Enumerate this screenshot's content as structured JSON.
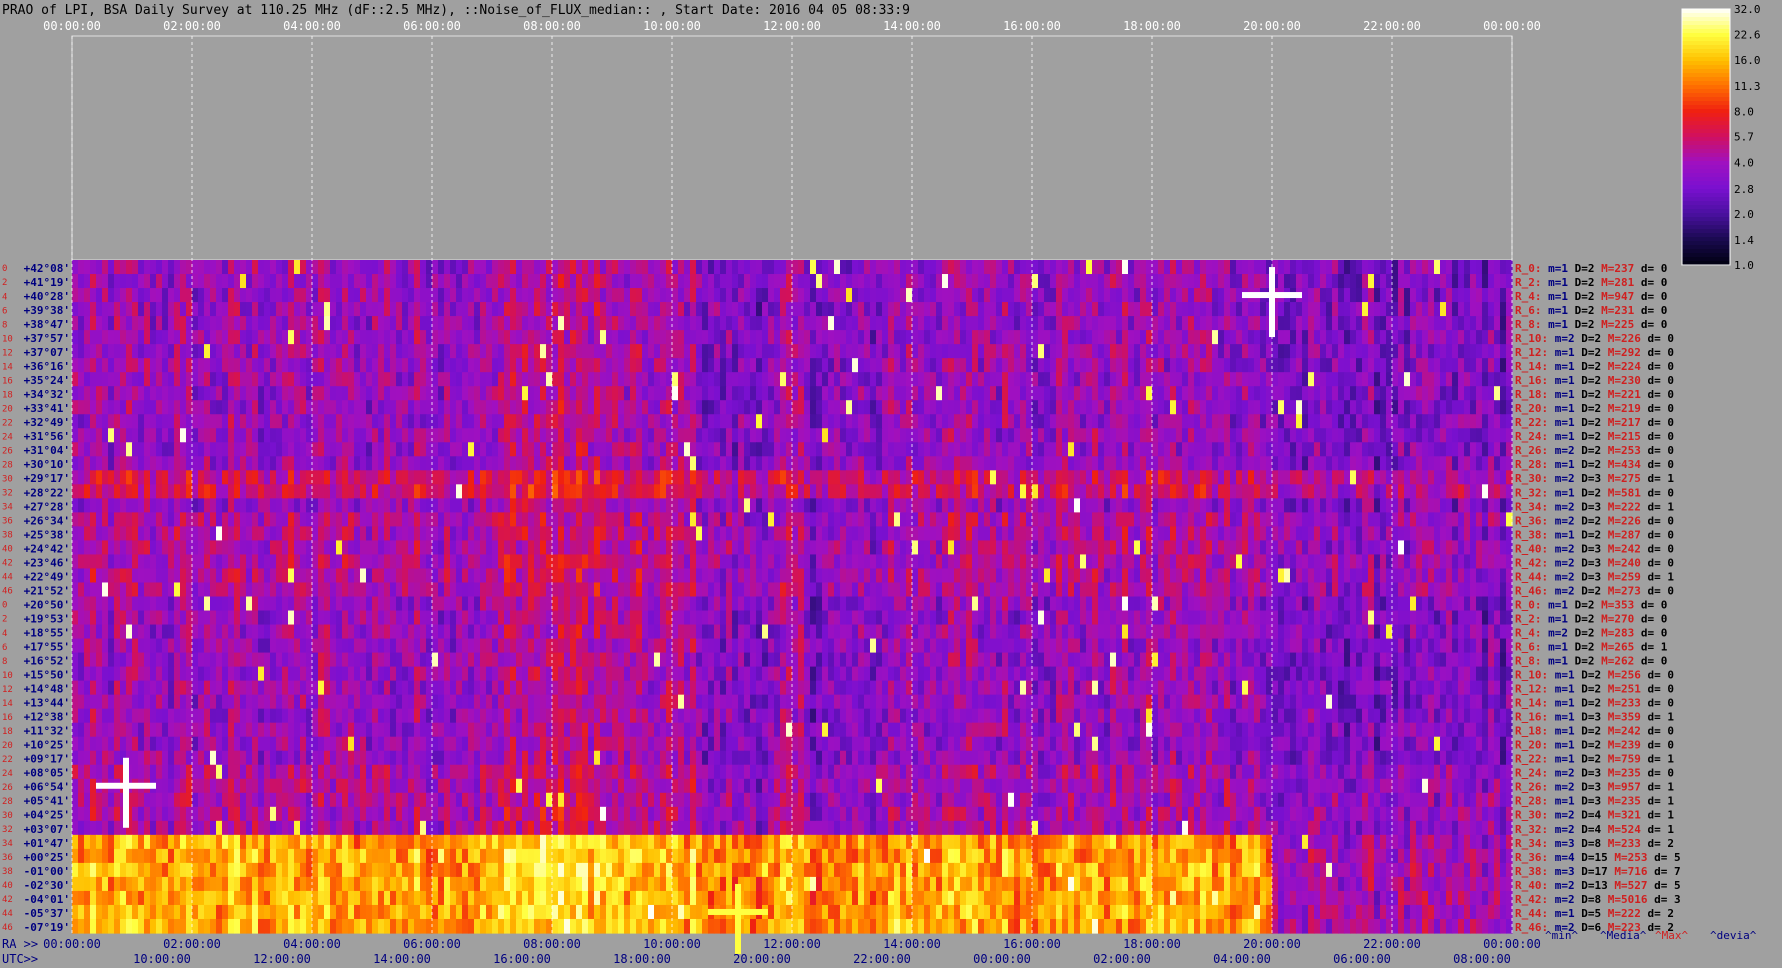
{
  "chart_data": {
    "type": "heatmap",
    "title": "PRAO of LPI, BSA Daily Survey at 110.25 MHz (dF::2.5 MHz), ::Noise_of_FLUX_median:: , Start Date: 2016 04 05 08:33:9",
    "top_time_ticks": [
      "00:00:00",
      "02:00:00",
      "04:00:00",
      "06:00:00",
      "08:00:00",
      "10:00:00",
      "12:00:00",
      "14:00:00",
      "16:00:00",
      "18:00:00",
      "20:00:00",
      "22:00:00",
      "00:00:00"
    ],
    "ra_axis_label": "RA >>",
    "ra_ticks": [
      "00:00:00",
      "02:00:00",
      "04:00:00",
      "06:00:00",
      "08:00:00",
      "10:00:00",
      "12:00:00",
      "14:00:00",
      "16:00:00",
      "18:00:00",
      "20:00:00",
      "22:00:00",
      "00:00:00"
    ],
    "utc_axis_label": "UTC>>",
    "utc_ticks": [
      "10:00:00",
      "12:00:00",
      "14:00:00",
      "16:00:00",
      "18:00:00",
      "20:00:00",
      "22:00:00",
      "00:00:00",
      "02:00:00",
      "04:00:00",
      "06:00:00",
      "08:00:00"
    ],
    "row_indices": [
      "0",
      "2",
      "4",
      "6",
      "8",
      "10",
      "12",
      "14",
      "16",
      "18",
      "20",
      "22",
      "24",
      "26",
      "28",
      "30",
      "32",
      "34",
      "36",
      "38",
      "40",
      "42",
      "44",
      "46",
      "0",
      "2",
      "4",
      "6",
      "8",
      "10",
      "12",
      "14",
      "16",
      "18",
      "20",
      "22",
      "24",
      "26",
      "28",
      "30",
      "32",
      "34",
      "36",
      "38",
      "40",
      "42",
      "44",
      "46"
    ],
    "declinations": [
      "+42°08'",
      "+41°19'",
      "+40°28'",
      "+39°38'",
      "+38°47'",
      "+37°57'",
      "+37°07'",
      "+36°16'",
      "+35°24'",
      "+34°32'",
      "+33°41'",
      "+32°49'",
      "+31°56'",
      "+31°04'",
      "+30°10'",
      "+29°17'",
      "+28°22'",
      "+27°28'",
      "+26°34'",
      "+25°38'",
      "+24°42'",
      "+23°46'",
      "+22°49'",
      "+21°52'",
      "+20°50'",
      "+19°53'",
      "+18°55'",
      "+17°55'",
      "+16°52'",
      "+15°50'",
      "+14°48'",
      "+13°44'",
      "+12°38'",
      "+11°32'",
      "+10°25'",
      "+09°17'",
      "+08°05'",
      "+06°54'",
      "+05°41'",
      "+04°25'",
      "+03°07'",
      "+01°47'",
      "+00°25'",
      "-01°00'",
      "-02°30'",
      "-04°01'",
      "-05°37'",
      "-07°19'"
    ],
    "row_stats": [
      {
        "r": "R_0:",
        "m": "m=1",
        "D": "D=2",
        "M": "M=237",
        "d": "d= 0"
      },
      {
        "r": "R_2:",
        "m": "m=1",
        "D": "D=2",
        "M": "M=281",
        "d": "d= 0"
      },
      {
        "r": "R_4:",
        "m": "m=1",
        "D": "D=2",
        "M": "M=947",
        "d": "d= 0"
      },
      {
        "r": "R_6:",
        "m": "m=1",
        "D": "D=2",
        "M": "M=231",
        "d": "d= 0"
      },
      {
        "r": "R_8:",
        "m": "m=1",
        "D": "D=2",
        "M": "M=225",
        "d": "d= 0"
      },
      {
        "r": "R_10:",
        "m": "m=2",
        "D": "D=2",
        "M": "M=226",
        "d": "d= 0"
      },
      {
        "r": "R_12:",
        "m": "m=1",
        "D": "D=2",
        "M": "M=292",
        "d": "d= 0"
      },
      {
        "r": "R_14:",
        "m": "m=1",
        "D": "D=2",
        "M": "M=224",
        "d": "d= 0"
      },
      {
        "r": "R_16:",
        "m": "m=1",
        "D": "D=2",
        "M": "M=230",
        "d": "d= 0"
      },
      {
        "r": "R_18:",
        "m": "m=1",
        "D": "D=2",
        "M": "M=221",
        "d": "d= 0"
      },
      {
        "r": "R_20:",
        "m": "m=1",
        "D": "D=2",
        "M": "M=219",
        "d": "d= 0"
      },
      {
        "r": "R_22:",
        "m": "m=1",
        "D": "D=2",
        "M": "M=217",
        "d": "d= 0"
      },
      {
        "r": "R_24:",
        "m": "m=1",
        "D": "D=2",
        "M": "M=215",
        "d": "d= 0"
      },
      {
        "r": "R_26:",
        "m": "m=2",
        "D": "D=2",
        "M": "M=253",
        "d": "d= 0"
      },
      {
        "r": "R_28:",
        "m": "m=1",
        "D": "D=2",
        "M": "M=434",
        "d": "d= 0"
      },
      {
        "r": "R_30:",
        "m": "m=2",
        "D": "D=3",
        "M": "M=275",
        "d": "d= 1"
      },
      {
        "r": "R_32:",
        "m": "m=1",
        "D": "D=2",
        "M": "M=581",
        "d": "d= 0"
      },
      {
        "r": "R_34:",
        "m": "m=2",
        "D": "D=3",
        "M": "M=222",
        "d": "d= 1"
      },
      {
        "r": "R_36:",
        "m": "m=2",
        "D": "D=2",
        "M": "M=226",
        "d": "d= 0"
      },
      {
        "r": "R_38:",
        "m": "m=1",
        "D": "D=2",
        "M": "M=287",
        "d": "d= 0"
      },
      {
        "r": "R_40:",
        "m": "m=2",
        "D": "D=3",
        "M": "M=242",
        "d": "d= 0"
      },
      {
        "r": "R_42:",
        "m": "m=2",
        "D": "D=3",
        "M": "M=240",
        "d": "d= 0"
      },
      {
        "r": "R_44:",
        "m": "m=2",
        "D": "D=3",
        "M": "M=259",
        "d": "d= 1"
      },
      {
        "r": "R_46:",
        "m": "m=2",
        "D": "D=2",
        "M": "M=273",
        "d": "d= 0"
      },
      {
        "r": "R_0:",
        "m": "m=1",
        "D": "D=2",
        "M": "M=353",
        "d": "d= 0"
      },
      {
        "r": "R_2:",
        "m": "m=1",
        "D": "D=2",
        "M": "M=270",
        "d": "d= 0"
      },
      {
        "r": "R_4:",
        "m": "m=2",
        "D": "D=2",
        "M": "M=283",
        "d": "d= 0"
      },
      {
        "r": "R_6:",
        "m": "m=1",
        "D": "D=2",
        "M": "M=265",
        "d": "d= 1"
      },
      {
        "r": "R_8:",
        "m": "m=1",
        "D": "D=2",
        "M": "M=262",
        "d": "d= 0"
      },
      {
        "r": "R_10:",
        "m": "m=1",
        "D": "D=2",
        "M": "M=256",
        "d": "d= 0"
      },
      {
        "r": "R_12:",
        "m": "m=1",
        "D": "D=2",
        "M": "M=251",
        "d": "d= 0"
      },
      {
        "r": "R_14:",
        "m": "m=1",
        "D": "D=2",
        "M": "M=233",
        "d": "d= 0"
      },
      {
        "r": "R_16:",
        "m": "m=1",
        "D": "D=3",
        "M": "M=359",
        "d": "d= 1"
      },
      {
        "r": "R_18:",
        "m": "m=1",
        "D": "D=2",
        "M": "M=242",
        "d": "d= 0"
      },
      {
        "r": "R_20:",
        "m": "m=1",
        "D": "D=2",
        "M": "M=239",
        "d": "d= 0"
      },
      {
        "r": "R_22:",
        "m": "m=1",
        "D": "D=2",
        "M": "M=759",
        "d": "d= 1"
      },
      {
        "r": "R_24:",
        "m": "m=2",
        "D": "D=3",
        "M": "M=235",
        "d": "d= 0"
      },
      {
        "r": "R_26:",
        "m": "m=2",
        "D": "D=3",
        "M": "M=957",
        "d": "d= 1"
      },
      {
        "r": "R_28:",
        "m": "m=1",
        "D": "D=3",
        "M": "M=235",
        "d": "d= 1"
      },
      {
        "r": "R_30:",
        "m": "m=2",
        "D": "D=4",
        "M": "M=321",
        "d": "d= 1"
      },
      {
        "r": "R_32:",
        "m": "m=2",
        "D": "D=4",
        "M": "M=524",
        "d": "d= 1"
      },
      {
        "r": "R_34:",
        "m": "m=3",
        "D": "D=8",
        "M": "M=233",
        "d": "d= 2"
      },
      {
        "r": "R_36:",
        "m": "m=4",
        "D": "D=15",
        "M": "M=253",
        "d": "d= 5"
      },
      {
        "r": "R_38:",
        "m": "m=3",
        "D": "D=17",
        "M": "M=716",
        "d": "d= 7"
      },
      {
        "r": "R_40:",
        "m": "m=2",
        "D": "D=13",
        "M": "M=527",
        "d": "d= 5"
      },
      {
        "r": "R_42:",
        "m": "m=2",
        "D": "D=8",
        "M": "M=5016",
        "d": "d= 3"
      },
      {
        "r": "R_44:",
        "m": "m=1",
        "D": "D=5",
        "M": "M=222",
        "d": "d= 2"
      },
      {
        "r": "R_46:",
        "m": "m=2",
        "D": "D=6",
        "M": "M=223",
        "d": "d= 2"
      }
    ],
    "stats_legend": [
      "^min^",
      "^Media^",
      "^Max^",
      "^devia^"
    ],
    "colorbar_ticks": [
      "32.0",
      "22.6",
      "16.0",
      "11.3",
      "8.0",
      "5.7",
      "4.0",
      "2.8",
      "2.0",
      "1.4",
      "1.0"
    ],
    "colorbar_range": [
      1.0,
      32.0
    ],
    "colorbar_scale": "log",
    "colormap": [
      "#000010",
      "#1a0a50",
      "#4a10a0",
      "#7a10d0",
      "#a010c0",
      "#d01060",
      "#f02010",
      "#ff7000",
      "#ffc000",
      "#ffff40",
      "#ffffff"
    ],
    "background_color": "#a0a0a0",
    "row_label_color": "#d02020",
    "dec_label_color": "#000080",
    "stats_colors": {
      "r": "#d02020",
      "m": "#000080",
      "D": "#000000",
      "M": "#d02020",
      "d": "#000000"
    },
    "hot_spots": [
      {
        "hour": 20.0,
        "dec": "+40°28'",
        "level": 32.0
      },
      {
        "hour": 0.9,
        "dec": "+06°54'",
        "level": 32.0
      },
      {
        "hour": 11.1,
        "dec": "-05°37'",
        "level": 22.6
      }
    ]
  }
}
